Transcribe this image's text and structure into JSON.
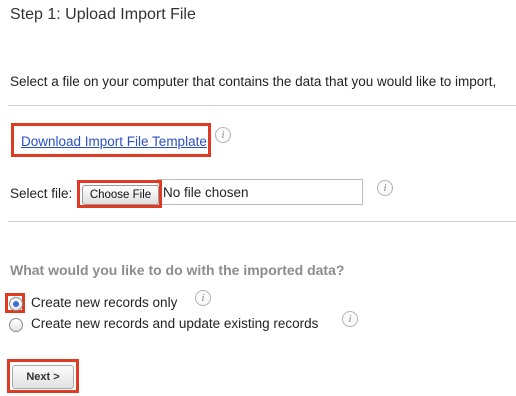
{
  "page": {
    "title": "Step 1: Upload Import File",
    "intro": "Select a file on your computer that contains the data that you would like to import,"
  },
  "template_link": {
    "label": "Download Import File Template",
    "icon": "info-icon"
  },
  "file_select": {
    "label": "Select file:",
    "button_label": "Choose File",
    "status": "No file chosen",
    "icon": "info-icon"
  },
  "import_options": {
    "question": "What would you like to do with the imported data?",
    "options": [
      {
        "label": "Create new records only",
        "selected": true
      },
      {
        "label": "Create new records and update existing records",
        "selected": false
      }
    ]
  },
  "actions": {
    "next_label": "Next >"
  },
  "colors": {
    "highlight": "#e13a23",
    "link": "#2b4fc7",
    "question": "#8c8c8c"
  }
}
